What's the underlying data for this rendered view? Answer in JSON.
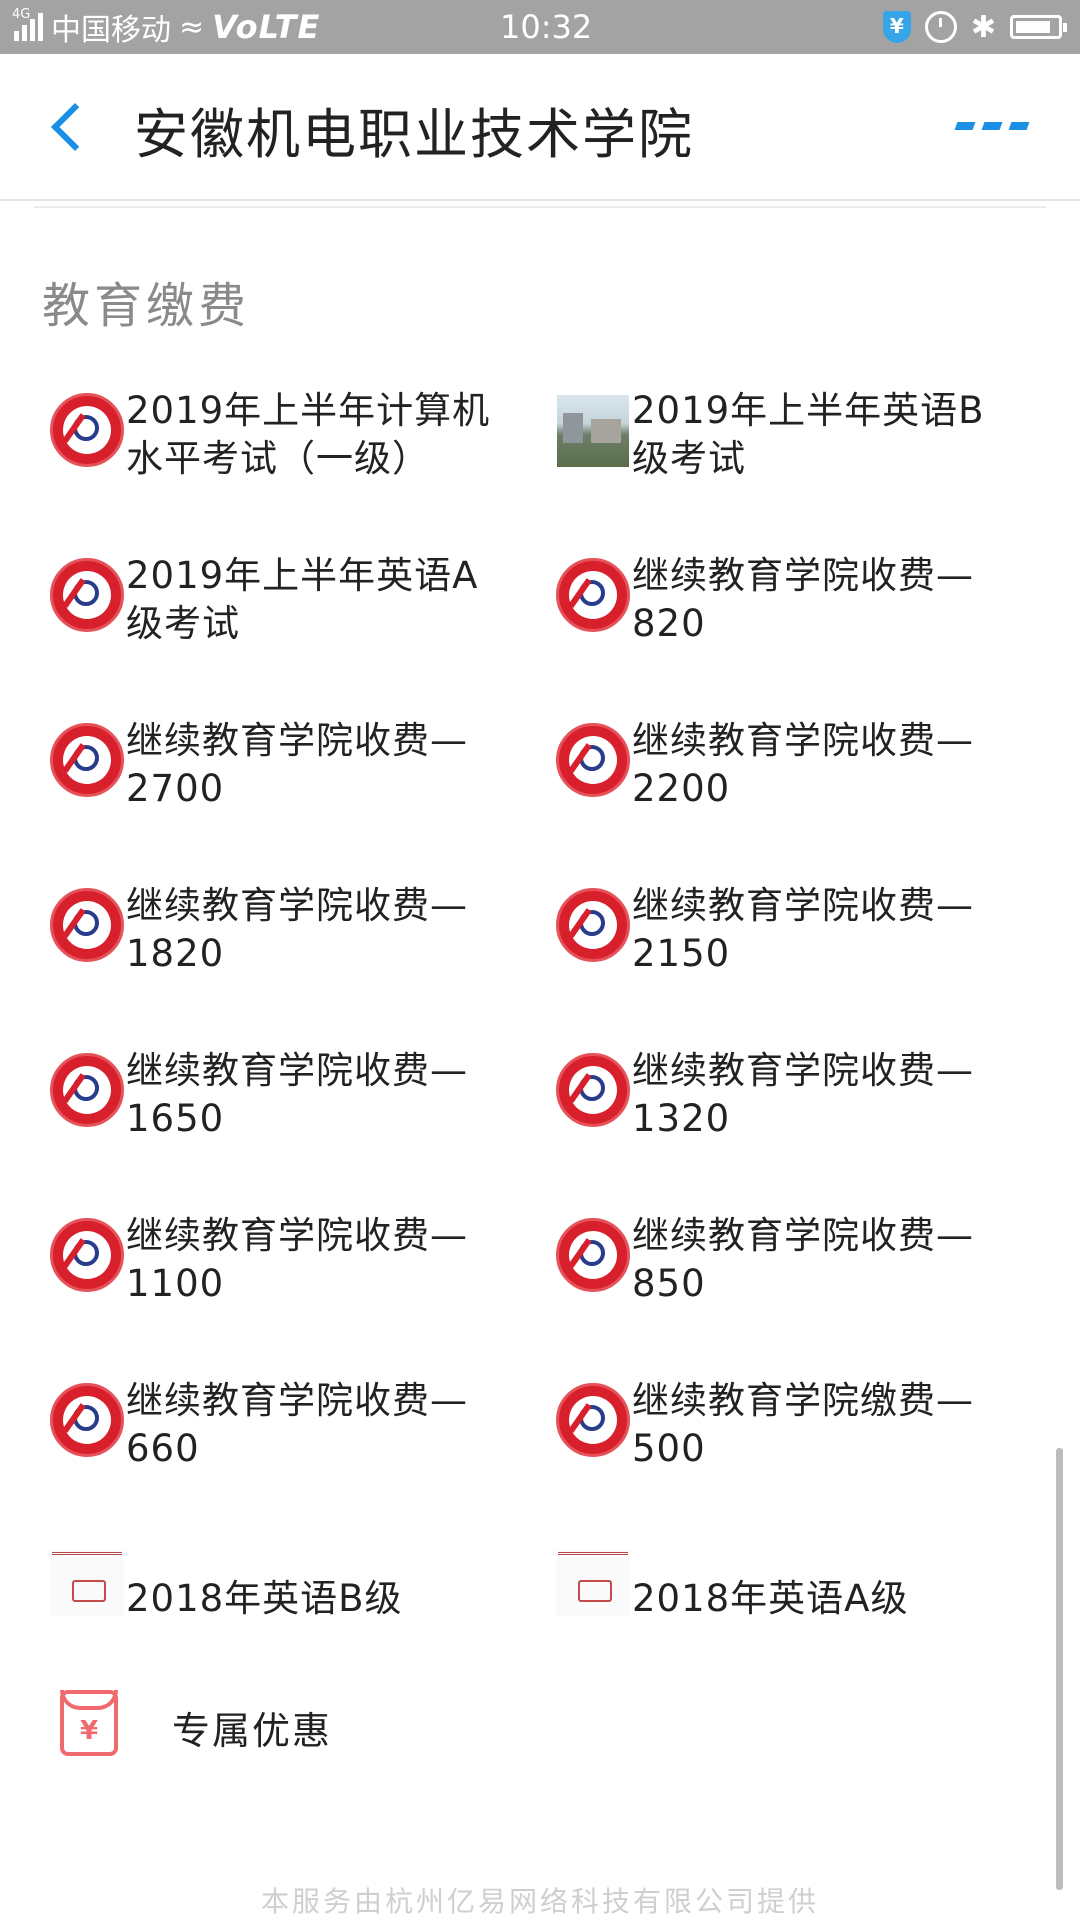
{
  "status_bar": {
    "network_tag": "4G",
    "carrier": "中国移动",
    "volte": "VoLTE",
    "time": "10:32",
    "icons": [
      "signal-icon",
      "wifi-icon",
      "shield-yen-icon",
      "alarm-icon",
      "bluetooth-icon",
      "battery-icon"
    ]
  },
  "header": {
    "title": "安徽机电职业技术学院",
    "back_icon": "chevron-left-icon",
    "more_icon": "more-dots-icon",
    "accent": "#1a8fe6"
  },
  "section": {
    "title": "教育缴费"
  },
  "items": [
    {
      "label": "2019年上半年计算机水平考试（一级）",
      "icon": "college-logo-icon"
    },
    {
      "label": "2019年上半年英语B级考试",
      "icon": "campus-photo-icon"
    },
    {
      "label": "2019年上半年英语A级考试",
      "icon": "college-logo-icon"
    },
    {
      "label": "继续教育学院收费—820",
      "icon": "college-logo-icon"
    },
    {
      "label": "继续教育学院收费—2700",
      "icon": "college-logo-icon"
    },
    {
      "label": "继续教育学院收费—2200",
      "icon": "college-logo-icon"
    },
    {
      "label": "继续教育学院收费—1820",
      "icon": "college-logo-icon"
    },
    {
      "label": "继续教育学院收费—2150",
      "icon": "college-logo-icon"
    },
    {
      "label": "继续教育学院收费—1650",
      "icon": "college-logo-icon"
    },
    {
      "label": "继续教育学院收费—1320",
      "icon": "college-logo-icon"
    },
    {
      "label": "继续教育学院收费—1100",
      "icon": "college-logo-icon"
    },
    {
      "label": "继续教育学院收费—850",
      "icon": "college-logo-icon"
    },
    {
      "label": "继续教育学院收费—660",
      "icon": "college-logo-icon"
    },
    {
      "label": "继续教育学院缴费—500",
      "icon": "college-logo-icon"
    },
    {
      "label": "2018年英语B级",
      "icon": "certificate-icon"
    },
    {
      "label": "2018年英语A级",
      "icon": "certificate-icon"
    }
  ],
  "special": {
    "label": "专属优惠",
    "icon": "red-envelope-icon",
    "yen": "¥"
  },
  "footer": {
    "text": "本服务由杭州亿易网络科技有限公司提供"
  }
}
